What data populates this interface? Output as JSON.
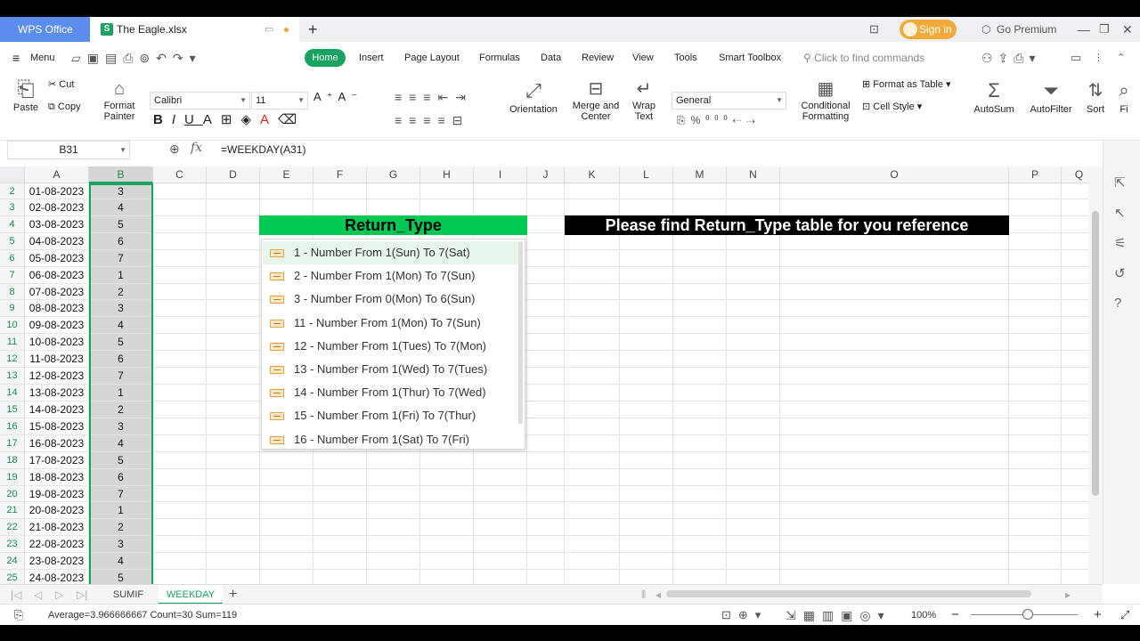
{
  "titlebar": {
    "wps_tab": "WPS Office",
    "file_tab": "The Eagle.xlsx",
    "sign_in": "Sign in",
    "go_premium": "Go Premium"
  },
  "menubar": {
    "menu": "Menu",
    "tabs": [
      "Home",
      "Insert",
      "Page Layout",
      "Formulas",
      "Data",
      "Review",
      "View",
      "Tools",
      "Smart Toolbox"
    ],
    "search_placeholder": "Click to find commands"
  },
  "ribbon": {
    "paste": "Paste",
    "cut": "Cut",
    "copy": "Copy",
    "format_painter_1": "Format",
    "format_painter_2": "Painter",
    "font_name": "Calibri",
    "font_size": "11",
    "orientation": "Orientation",
    "merge_1": "Merge and",
    "merge_2": "Center",
    "wrap_1": "Wrap",
    "wrap_2": "Text",
    "number_format": "General",
    "cond_1": "Conditional",
    "cond_2": "Formatting",
    "format_as_table": "Format as Table",
    "cell_style": "Cell Style",
    "autosum": "AutoSum",
    "autofilter": "AutoFilter",
    "sort": "Sort",
    "fi": "Fi"
  },
  "formula_bar": {
    "name_box": "B31",
    "fx": "fx",
    "formula": "=WEEKDAY(A31)"
  },
  "columns": [
    "A",
    "B",
    "C",
    "D",
    "E",
    "F",
    "G",
    "H",
    "I",
    "J",
    "K",
    "L",
    "M",
    "N",
    "O",
    "P",
    "Q"
  ],
  "rows": [
    {
      "num": "2",
      "a": "01-08-2023",
      "b": "3"
    },
    {
      "num": "3",
      "a": "02-08-2023",
      "b": "4"
    },
    {
      "num": "4",
      "a": "03-08-2023",
      "b": "5"
    },
    {
      "num": "5",
      "a": "04-08-2023",
      "b": "6"
    },
    {
      "num": "6",
      "a": "05-08-2023",
      "b": "7"
    },
    {
      "num": "7",
      "a": "06-08-2023",
      "b": "1"
    },
    {
      "num": "8",
      "a": "07-08-2023",
      "b": "2"
    },
    {
      "num": "9",
      "a": "08-08-2023",
      "b": "3"
    },
    {
      "num": "10",
      "a": "09-08-2023",
      "b": "4"
    },
    {
      "num": "11",
      "a": "10-08-2023",
      "b": "5"
    },
    {
      "num": "12",
      "a": "11-08-2023",
      "b": "6"
    },
    {
      "num": "13",
      "a": "12-08-2023",
      "b": "7"
    },
    {
      "num": "14",
      "a": "13-08-2023",
      "b": "1"
    },
    {
      "num": "15",
      "a": "14-08-2023",
      "b": "2"
    },
    {
      "num": "16",
      "a": "15-08-2023",
      "b": "3"
    },
    {
      "num": "17",
      "a": "16-08-2023",
      "b": "4"
    },
    {
      "num": "18",
      "a": "17-08-2023",
      "b": "5"
    },
    {
      "num": "19",
      "a": "18-08-2023",
      "b": "6"
    },
    {
      "num": "20",
      "a": "19-08-2023",
      "b": "7"
    },
    {
      "num": "21",
      "a": "20-08-2023",
      "b": "1"
    },
    {
      "num": "22",
      "a": "21-08-2023",
      "b": "2"
    },
    {
      "num": "23",
      "a": "22-08-2023",
      "b": "3"
    },
    {
      "num": "24",
      "a": "23-08-2023",
      "b": "4"
    },
    {
      "num": "25",
      "a": "24-08-2023",
      "b": "5"
    }
  ],
  "banners": {
    "return_type": "Return_Type",
    "reference": "Please find Return_Type table for you reference"
  },
  "dropdown_items": [
    "1 - Number From 1(Sun) To 7(Sat)",
    "2 - Number From 1(Mon) To 7(Sun)",
    "3 - Number From 0(Mon) To 6(Sun)",
    "11 - Number From 1(Mon) To 7(Sun)",
    "12 - Number From 1(Tues) To 7(Mon)",
    "13 - Number From 1(Wed) To 7(Tues)",
    "14 - Number From 1(Thur) To 7(Wed)",
    "15 - Number From 1(Fri) To 7(Thur)",
    "16 - Number From 1(Sat) To 7(Fri)"
  ],
  "sheets": [
    "SUMIF",
    "WEEKDAY"
  ],
  "status": {
    "summary": "Average=3.966666667  Count=30  Sum=119",
    "zoom": "100%"
  },
  "colors": {
    "accent": "#1aa260",
    "banner_green": "#00c853",
    "wps_blue": "#5b8def"
  }
}
